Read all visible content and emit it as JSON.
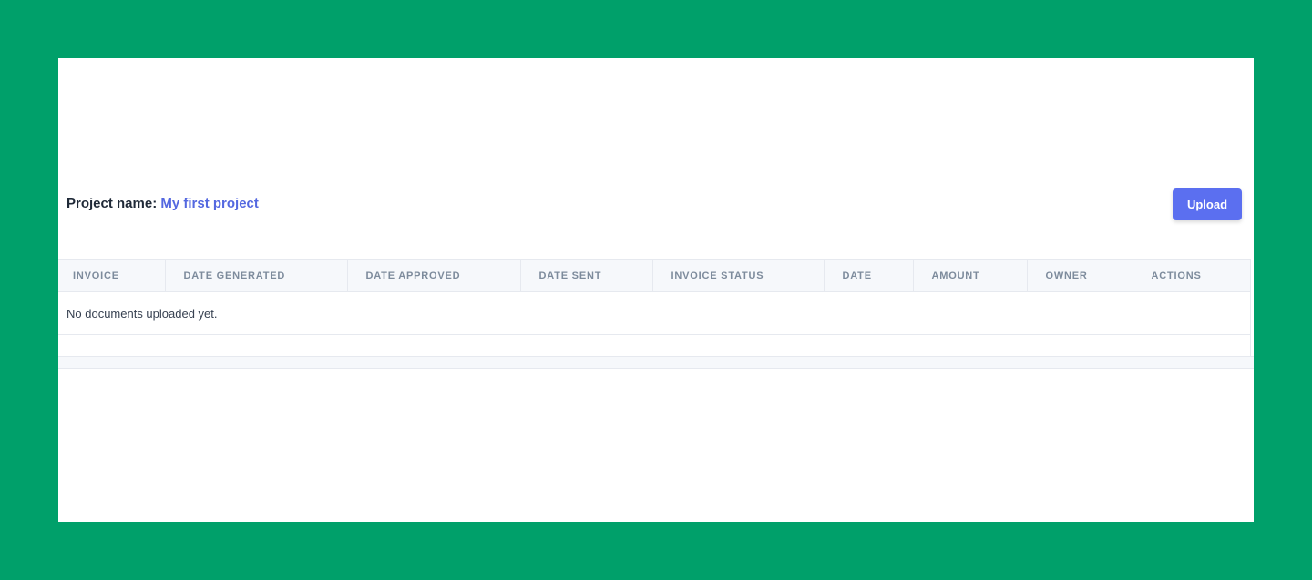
{
  "project": {
    "label": "Project name:",
    "name": "My first project"
  },
  "toolbar": {
    "upload_label": "Upload"
  },
  "table": {
    "columns": [
      "INVOICE",
      "DATE GENERATED",
      "DATE APPROVED",
      "DATE SENT",
      "INVOICE STATUS",
      "DATE",
      "AMOUNT",
      "OWNER",
      "ACTIONS"
    ],
    "empty_message": "No documents uploaded yet."
  },
  "colors": {
    "background": "#00a06a",
    "accent": "#5b6ff0",
    "project_name": "#5468e0",
    "header_bg": "#f6f8fb",
    "header_text": "#7d8b9c"
  }
}
